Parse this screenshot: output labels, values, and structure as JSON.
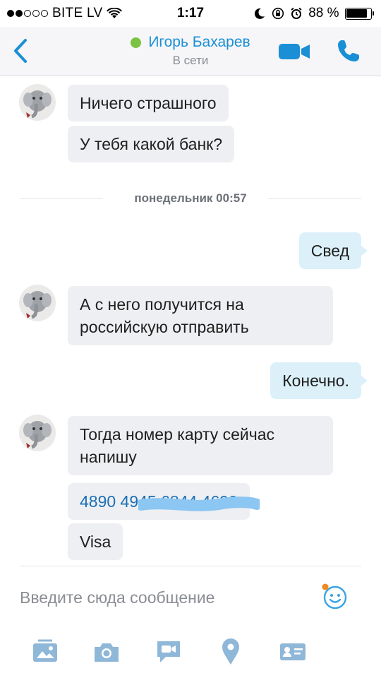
{
  "status_bar": {
    "carrier": "BITE LV",
    "time": "1:17",
    "battery_percent": "88 %",
    "battery_level": 0.88
  },
  "header": {
    "contact_name": "Игорь Бахарев",
    "presence": "В сети",
    "presence_color": "#7cc242",
    "accent_color": "#1a8fd6"
  },
  "messages": [
    {
      "side": "in",
      "text": "Ничего страшного"
    },
    {
      "side": "in",
      "text": "У тебя какой банк?"
    },
    {
      "type": "date_separator",
      "text": "понедельник 00:57"
    },
    {
      "side": "out",
      "text": "Свед"
    },
    {
      "side": "in",
      "text": "А с него получится на российскую отправить"
    },
    {
      "side": "out",
      "text": "Конечно."
    },
    {
      "side": "in",
      "text": "Тогда номер карту сейчас напишу"
    },
    {
      "side": "in",
      "text": "4890 4945 6844 4693",
      "style": "link",
      "partially_obscured": true
    },
    {
      "side": "in",
      "text": "Visa"
    }
  ],
  "composer": {
    "placeholder": "Введите сюда сообщение"
  },
  "toolbar_icons": [
    "media-gallery-icon",
    "camera-icon",
    "video-message-icon",
    "location-pin-icon",
    "contact-card-icon"
  ]
}
